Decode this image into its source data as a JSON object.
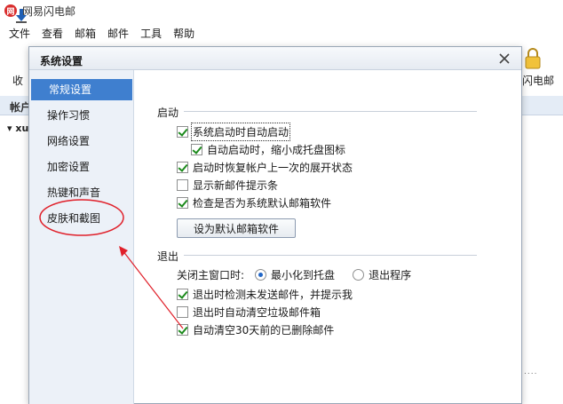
{
  "app": {
    "title": "网易闪电邮",
    "logo_glyph": "网",
    "menus": [
      "文件",
      "查看",
      "邮箱",
      "邮件",
      "工具",
      "帮助"
    ],
    "toolbar_left_label": "收",
    "account_strip_label": "帐户",
    "account_node_label": "xu",
    "toolbar_right_label": "闪电邮",
    "right_dots": "....",
    "colors": {
      "logo": "#d92d2d",
      "strip": "#e4ecf6"
    }
  },
  "dialog": {
    "title": "系统设置",
    "close_icon": "close-icon",
    "nav": [
      {
        "label": "常规设置",
        "active": true
      },
      {
        "label": "操作习惯",
        "active": false
      },
      {
        "label": "网络设置",
        "active": false
      },
      {
        "label": "加密设置",
        "active": false
      },
      {
        "label": "热键和声音",
        "active": false
      },
      {
        "label": "皮肤和截图",
        "active": false
      }
    ],
    "startup": {
      "header": "启动",
      "options": [
        {
          "label": "系统启动时自动启动",
          "checked": true
        },
        {
          "label": "自动启动时，缩小成托盘图标",
          "checked": true
        },
        {
          "label": "启动时恢复帐户上一次的展开状态",
          "checked": true
        },
        {
          "label": "显示新邮件提示条",
          "checked": false
        },
        {
          "label": "检查是否为系统默认邮箱软件",
          "checked": true
        }
      ],
      "default_button": "设为默认邮箱软件"
    },
    "exit": {
      "header": "退出",
      "close_label": "关闭主窗口时:",
      "radio_minimize": "最小化到托盘",
      "radio_quit": "退出程序",
      "selected": "最小化到托盘",
      "options": [
        {
          "label": "退出时检测未发送邮件，并提示我",
          "checked": true
        },
        {
          "label": "退出时自动清空垃圾邮件箱",
          "checked": false
        },
        {
          "label": "自动清空30天前的已删除邮件",
          "checked": true
        }
      ]
    },
    "colors": {
      "nav_active": "#3f7fcf",
      "nav_bg": "#ecf1f8",
      "check": "#1c8a1c",
      "annotation": "#e0202a"
    }
  }
}
